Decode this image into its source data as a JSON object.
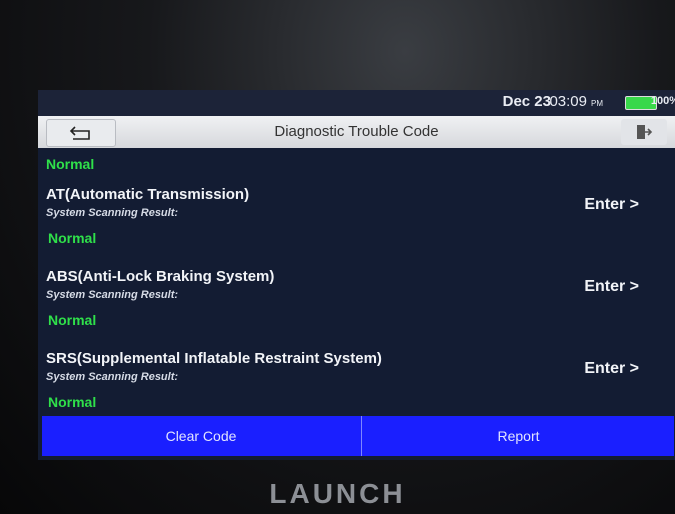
{
  "status_bar": {
    "date": "Dec 23",
    "time": "03:09",
    "ampm": "PM",
    "battery": "100%"
  },
  "header": {
    "title": "Diagnostic Trouble Code"
  },
  "top_partial": {
    "status": "Normal"
  },
  "items": [
    {
      "name": "AT(Automatic Transmission)",
      "result_label": "System Scanning Result:",
      "status": "Normal",
      "action": "Enter >"
    },
    {
      "name": "ABS(Anti-Lock Braking System)",
      "result_label": "System Scanning Result:",
      "status": "Normal",
      "action": "Enter >"
    },
    {
      "name": "SRS(Supplemental Inflatable Restraint System)",
      "result_label": "System Scanning Result:",
      "status": "Normal",
      "action": "Enter >"
    }
  ],
  "footer": {
    "clear_label": "Clear Code",
    "report_label": "Report"
  },
  "brand": "LAUNCH",
  "colors": {
    "status_normal": "#2fe04a",
    "footer_bar": "#1a1fff"
  },
  "icons": {
    "back": "back-arrow-icon",
    "exit": "exit-icon"
  }
}
